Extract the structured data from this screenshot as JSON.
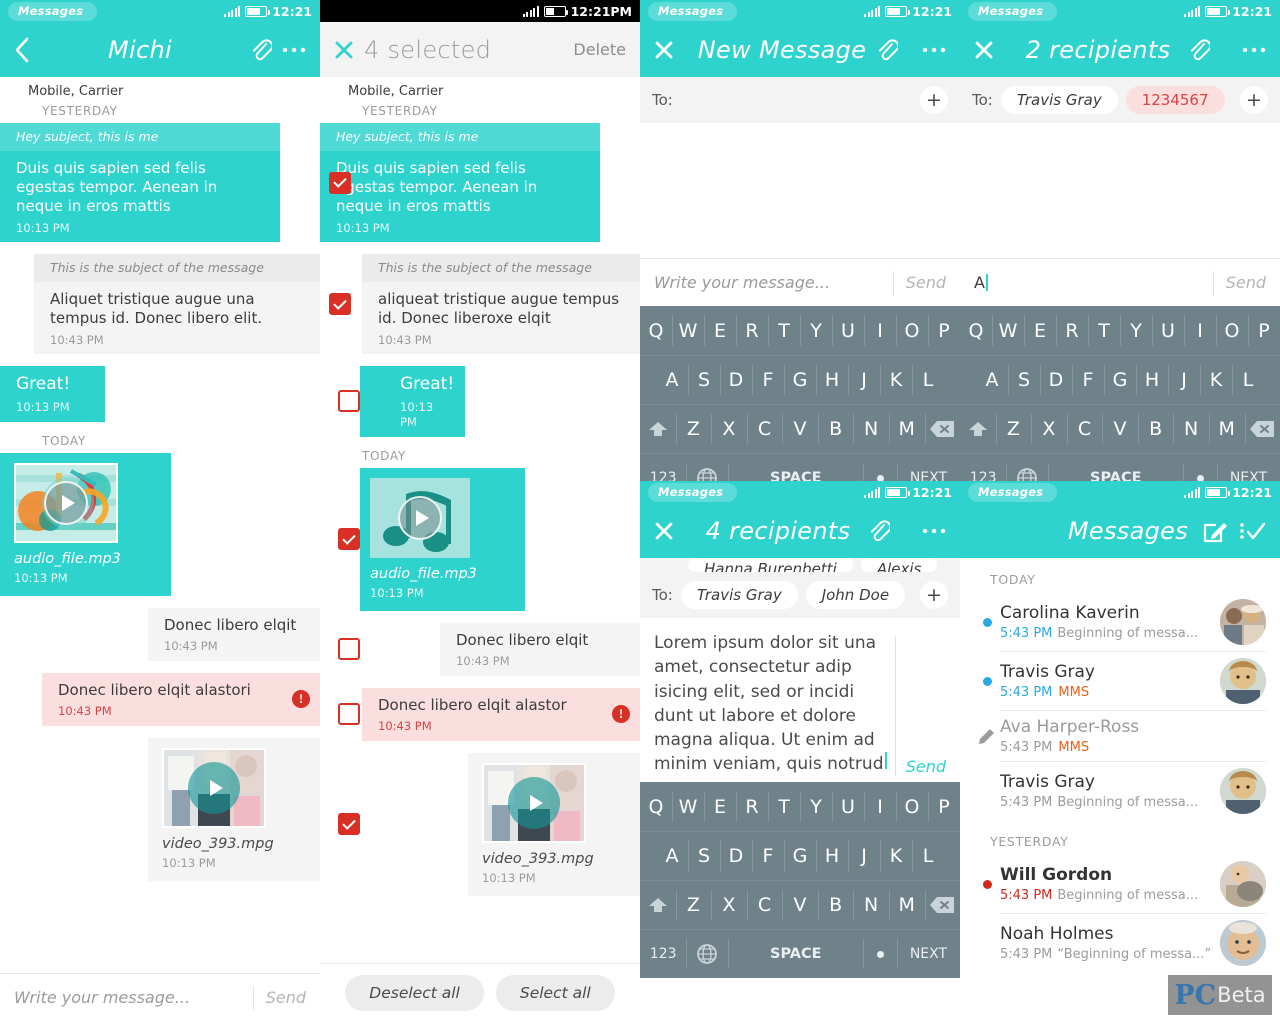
{
  "statusbar": {
    "app_label": "Messages",
    "time": "12:21",
    "time_pm": "12:21PM"
  },
  "panel1": {
    "header": {
      "back_icon": "chevron-left-icon",
      "title": "Michi",
      "attach_icon": "paperclip-icon",
      "more_icon": "overflow-menu-icon"
    },
    "carrier": "Mobile, Carrier",
    "day_yesterday": "YESTERDAY",
    "day_today": "TODAY",
    "messages": [
      {
        "subject": "Hey subject, this is me",
        "text": "Duis quis sapien sed felis egestas tempor. Aenean in neque in eros mattis",
        "time": "10:13 PM"
      },
      {
        "subject": "This is the subject of the message",
        "text": "Aliquet tristique augue una tempus id. Donec libero elit.",
        "time": "10:43 PM"
      },
      {
        "text": "Great!",
        "time": "10:13 PM"
      },
      {
        "filename": "audio_file.mp3",
        "time": "10:13 PM"
      },
      {
        "text": "Donec libero elqit",
        "time": "10:43 PM"
      },
      {
        "text": "Donec libero elqit alastori",
        "time": "10:43 PM"
      },
      {
        "filename": "video_393.mpg",
        "time": "10:13 PM"
      }
    ],
    "composer": {
      "placeholder": "Write your message...",
      "send_label": "Send"
    }
  },
  "panel2": {
    "header": {
      "close_icon": "close-icon",
      "title": "4 selected",
      "delete_label": "Delete"
    },
    "carrier": "Mobile, Carrier",
    "day_yesterday": "YESTERDAY",
    "day_today": "TODAY",
    "messages": [
      {
        "subject": "Hey subject, this is me",
        "text": "Duis quis sapien sed felis egestas tempor. Aenean in neque in eros mattis",
        "time": "10:13 PM",
        "checked": true
      },
      {
        "subject": "This is the subject of the message",
        "text": "aliqueat tristique augue tempus id. Donec liberoxe elqit",
        "time": "10:43 PM",
        "checked": true
      },
      {
        "text": "Great!",
        "time": "10:13 PM",
        "checked": false
      },
      {
        "filename": "audio_file.mp3",
        "time": "10:13 PM",
        "checked": true
      },
      {
        "text": "Donec libero elqit",
        "time": "10:43 PM",
        "checked": false
      },
      {
        "text": "Donec libero elqit alastor",
        "time": "10:43 PM",
        "checked": false
      },
      {
        "filename": "video_393.mpg",
        "time": "10:13 PM",
        "checked": true
      }
    ],
    "deselect_all_label": "Deselect all",
    "select_all_label": "Select all"
  },
  "panel3": {
    "header": {
      "close_icon": "close-icon",
      "title": "New Message",
      "attach_icon": "paperclip-icon",
      "more_icon": "overflow-menu-icon"
    },
    "to_label": "To:",
    "add_label": "+",
    "composer": {
      "placeholder": "Write your message...",
      "send_label": "Send"
    }
  },
  "panel4": {
    "header": {
      "close_icon": "close-icon",
      "title": "2 recipients",
      "attach_icon": "paperclip-icon",
      "more_icon": "overflow-menu-icon"
    },
    "to_label": "To:",
    "chips": [
      {
        "label": "Travis Gray",
        "invalid": false
      },
      {
        "label": "1234567",
        "invalid": true
      }
    ],
    "add_label": "+",
    "composer": {
      "value": "A",
      "send_label": "Send"
    }
  },
  "panel5": {
    "header": {
      "close_icon": "close-icon",
      "title": "4 recipients",
      "attach_icon": "paperclip-icon",
      "more_icon": "overflow-menu-icon"
    },
    "to_label": "To:",
    "chips_overflow": [
      "Hanna Burenbetti",
      "Alexis"
    ],
    "chips": [
      "Travis Gray",
      "John Doe"
    ],
    "add_label": "+",
    "composer": {
      "value": "Lorem ipsum dolor sit una amet, consectetur adip isicing elit, sed or incidi dunt ut labore et dolore magna aliqua. Ut enim ad minim veniam, quis notrud",
      "send_label": "Send"
    }
  },
  "panel6": {
    "header": {
      "title": "Messages",
      "compose_icon": "compose-pencil-icon",
      "menu_icon": "overflow-check-icon"
    },
    "sections": [
      {
        "label": "TODAY",
        "items": [
          {
            "name": "Carolina Kaverin",
            "time": "5:43 PM",
            "preview": "Beginning of messa...",
            "status": "",
            "lead": "unread-dot-blue",
            "time_color": "blue"
          },
          {
            "name": "Travis Gray",
            "time": "5:43 PM",
            "preview": "",
            "status": "MMS",
            "lead": "unread-dot-blue",
            "time_color": "blue"
          },
          {
            "name": "Ava Harper-Ross",
            "time": "5:43 PM",
            "preview": "",
            "status": "MMS",
            "lead": "draft-pencil-icon",
            "time_color": "gray",
            "muted": true
          },
          {
            "name": "Travis Gray",
            "time": "5:43 PM",
            "preview": "Beginning of messa...",
            "status": "",
            "lead": "",
            "time_color": "gray"
          }
        ]
      },
      {
        "label": "YESTERDAY",
        "items": [
          {
            "name": "Will Gordon",
            "time": "5:43 PM",
            "preview": "Beginning of messa...",
            "status": "",
            "lead": "failed-dot-red",
            "time_color": "red"
          },
          {
            "name": "Noah Holmes",
            "time": "5:43 PM",
            "preview": "“Beginning of messa...”",
            "status": "",
            "lead": "",
            "time_color": "gray"
          }
        ]
      }
    ]
  },
  "keyboard": {
    "row1": [
      "Q",
      "W",
      "E",
      "R",
      "T",
      "Y",
      "U",
      "I",
      "O",
      "P"
    ],
    "row2": [
      "A",
      "S",
      "D",
      "F",
      "G",
      "H",
      "J",
      "K",
      "L"
    ],
    "row3_letters": [
      "Z",
      "X",
      "C",
      "V",
      "B",
      "N",
      "M"
    ],
    "shift_icon": "shift-up-icon",
    "backspace_icon": "backspace-icon",
    "num_label": "123",
    "globe_icon": "globe-language-icon",
    "space_label": "SPACE",
    "dot_label": ".",
    "next_label": "NEXT"
  },
  "watermark": {
    "pc": "PC",
    "beta": "Beta"
  },
  "colors": {
    "accent": "#2ed3cd",
    "error": "#d93025",
    "error_bg": "#fbdede",
    "unread": "#29a9e1",
    "mms": "#e8611a",
    "keyboard": "#6f8289"
  }
}
